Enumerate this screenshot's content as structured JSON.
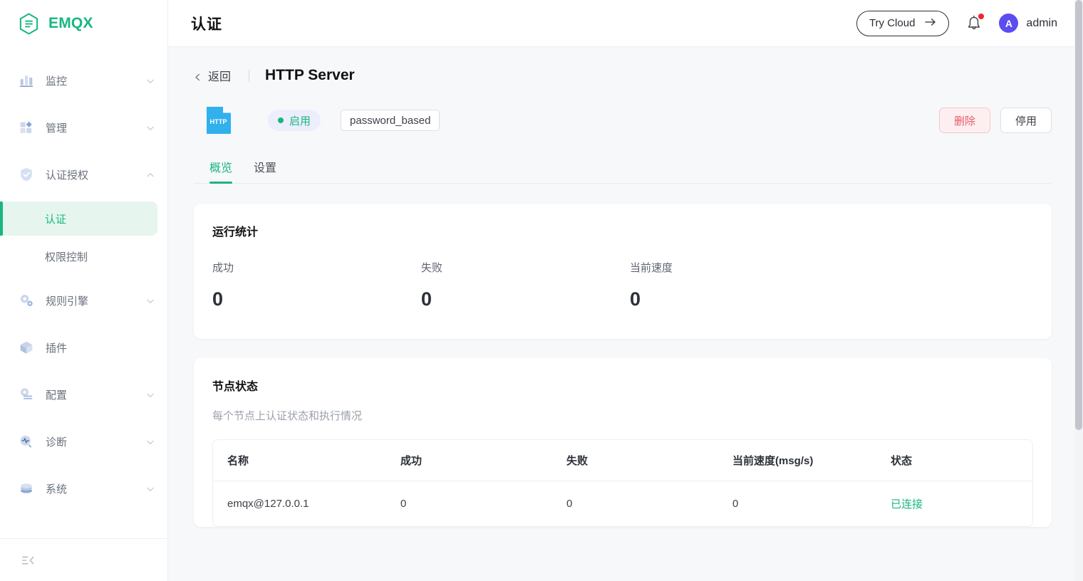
{
  "brand": {
    "name": "EMQX",
    "logo_icon": "emqx-hexagon-logo"
  },
  "sidebar": {
    "items": [
      {
        "label": "监控",
        "icon": "monitor-chart-icon",
        "chevron": "chevron-down-icon",
        "expandable": true
      },
      {
        "label": "管理",
        "icon": "management-blocks-icon",
        "chevron": "chevron-down-icon",
        "expandable": true
      },
      {
        "label": "认证授权",
        "icon": "shield-check-icon",
        "chevron": "chevron-up-icon",
        "expandable": true
      },
      {
        "label": "规则引擎",
        "icon": "gears-icon",
        "chevron": "chevron-down-icon",
        "expandable": true
      },
      {
        "label": "插件",
        "icon": "cube-icon",
        "chevron": "",
        "expandable": false
      },
      {
        "label": "配置",
        "icon": "config-gear-list-icon",
        "chevron": "chevron-down-icon",
        "expandable": true
      },
      {
        "label": "诊断",
        "icon": "diagnose-pulse-icon",
        "chevron": "chevron-down-icon",
        "expandable": true
      },
      {
        "label": "系统",
        "icon": "system-stack-icon",
        "chevron": "chevron-down-icon",
        "expandable": true
      }
    ],
    "sub_items": [
      {
        "label": "认证",
        "active": true
      },
      {
        "label": "权限控制",
        "active": false
      }
    ],
    "collapse_icon": "collapse-sidebar-icon",
    "accent_color": "#19b680",
    "active_bg_color": "#e6f6ef"
  },
  "topbar": {
    "title": "认证",
    "try_cloud_label": "Try Cloud",
    "try_cloud_arrow": "arrow-right-icon",
    "bell_icon": "bell-notification-icon",
    "has_unread": true,
    "avatar_initial": "A",
    "avatar_color": "#5b4df0",
    "user_name": "admin"
  },
  "breadcrumb": {
    "back_icon": "chevron-left-icon",
    "back_label": "返回",
    "detail_title": "HTTP Server"
  },
  "resource": {
    "icon_label": "HTTP",
    "icon_name": "http-file-icon",
    "icon_color": "#31b0ee",
    "status_label": "启用",
    "status_color": "#19b680",
    "type_tag": "password_based",
    "delete_label": "删除",
    "stop_label": "停用"
  },
  "tabs": [
    {
      "label": "概览",
      "active": true
    },
    {
      "label": "设置",
      "active": false
    }
  ],
  "run_stats": {
    "title": "运行统计",
    "items": [
      {
        "label": "成功",
        "value": "0"
      },
      {
        "label": "失败",
        "value": "0"
      },
      {
        "label": "当前速度",
        "value": "0"
      }
    ]
  },
  "node_status": {
    "title": "节点状态",
    "subtitle": "每个节点上认证状态和执行情况",
    "columns": [
      "名称",
      "成功",
      "失败",
      "当前速度(msg/s)",
      "状态"
    ],
    "rows": [
      {
        "name": "emqx@127.0.0.1",
        "success": "0",
        "failure": "0",
        "rate": "0",
        "status": "已连接"
      }
    ]
  }
}
